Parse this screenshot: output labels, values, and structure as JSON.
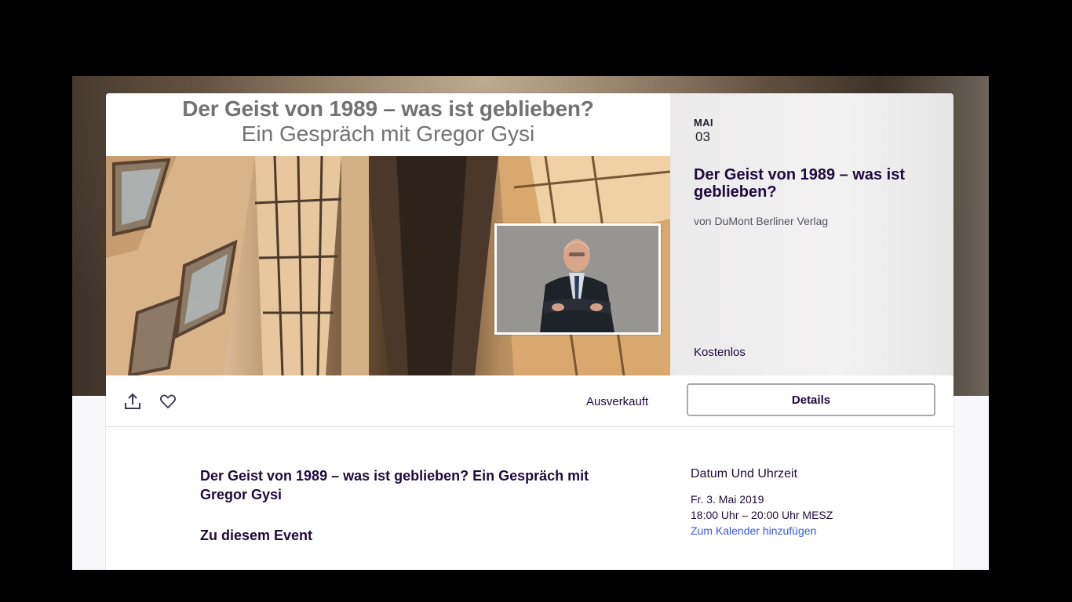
{
  "banner": {
    "line1": "Der Geist von 1989 – was ist geblieben?",
    "line2": "Ein Gespräch mit Gregor Gysi"
  },
  "event": {
    "month": "MAI",
    "day": "03",
    "title": "Der Geist von 1989 – was ist geblieben?",
    "organizer": "von DuMont Berliner Verlag",
    "price": "Kostenlos"
  },
  "actions": {
    "share_icon": "share-icon",
    "like_icon": "heart-icon",
    "status": "Ausverkauft",
    "details_label": "Details"
  },
  "content": {
    "heading": "Der Geist von 1989 – was ist geblieben? Ein Gespräch mit Gregor Gysi",
    "about_heading": "Zu diesem Event"
  },
  "sidebar": {
    "heading": "Datum Und Uhrzeit",
    "date": "Fr. 3. Mai 2019",
    "time": "18:00 Uhr – 20:00 Uhr MESZ",
    "calendar_link": "Zum Kalender hinzufügen"
  },
  "colors": {
    "text_primary": "#1e0a3c",
    "link": "#3659e3",
    "page_background": "#000000"
  }
}
